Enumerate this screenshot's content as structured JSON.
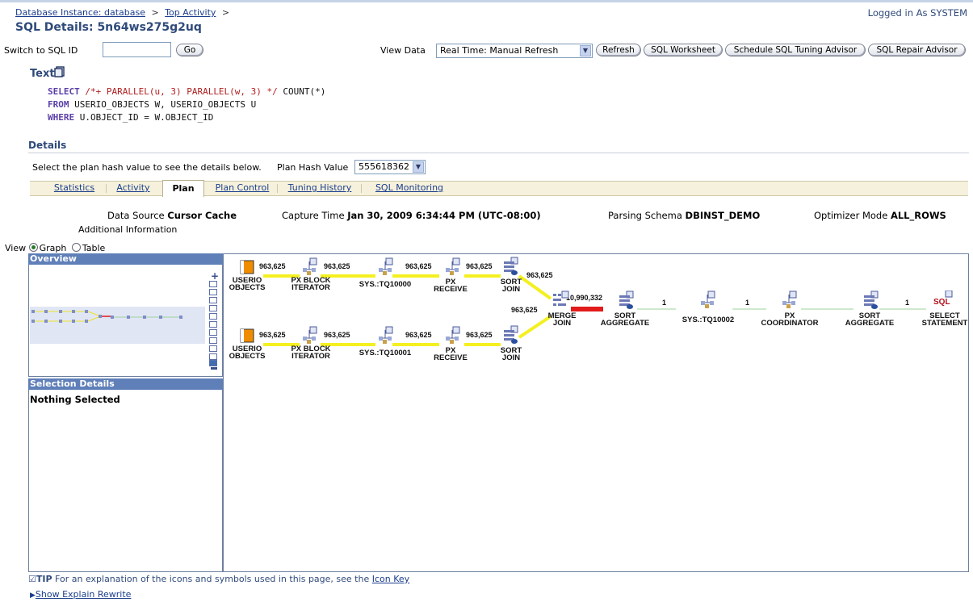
{
  "breadcrumb": {
    "instance": "Database Instance: database",
    "sep1": ">",
    "top_activity": "Top Activity",
    "sep2": ">"
  },
  "login": "Logged in As SYSTEM",
  "page_title": "SQL Details: 5n64ws275g2uq",
  "toolbar": {
    "switch_label": "Switch to SQL ID",
    "switch_value": "",
    "go": "Go",
    "view_data_label": "View Data",
    "view_data_value": "Real Time: Manual Refresh",
    "refresh": "Refresh",
    "sql_worksheet": "SQL Worksheet",
    "tuning_advisor": "Schedule SQL Tuning Advisor",
    "repair_advisor": "SQL Repair Advisor"
  },
  "text_section": {
    "title": "Text",
    "line1_kw": "SELECT",
    "line1_hint": " /*+ PARALLEL(u, 3) PARALLEL(w, 3) */",
    "line1_rest": " COUNT(*)",
    "line2_kw": "FROM",
    "line2_rest": " USERIO_OBJECTS W, USERIO_OBJECTS U",
    "line3_kw": "WHERE",
    "line3_rest": " U.OBJECT_ID = W.OBJECT_ID"
  },
  "details": {
    "title": "Details",
    "instruction": "Select the plan hash value to see the details below.",
    "hash_label": "Plan Hash Value",
    "hash_value": "555618362"
  },
  "tabs": [
    "Statistics",
    "Activity",
    "Plan",
    "Plan Control",
    "Tuning History",
    "SQL Monitoring"
  ],
  "info": {
    "data_source_label": "Data Source",
    "data_source": "Cursor Cache",
    "capture_label": "Capture Time",
    "capture": "Jan 30, 2009 6:34:44 PM (UTC-08:00)",
    "schema_label": "Parsing Schema",
    "schema": "DBINST_DEMO",
    "optimizer_label": "Optimizer Mode",
    "optimizer": "ALL_ROWS",
    "additional": "Additional Information"
  },
  "view": {
    "label": "View",
    "graph": "Graph",
    "table": "Table"
  },
  "overview_title": "Overview",
  "selection": {
    "title": "Selection Details",
    "text": "Nothing Selected"
  },
  "graph": {
    "top": {
      "n1a": "USERIO",
      "n1b": "OBJECTS",
      "e1": "963,625",
      "n2a": "PX BLOCK",
      "n2b": "ITERATOR",
      "e2": "963,625",
      "n3": "SYS.:TQ10000",
      "e3": "963,625",
      "n4a": "PX",
      "n4b": "RECEIVE",
      "e4": "963,625",
      "n5a": "SORT",
      "n5b": "JOIN",
      "e5": "963,625"
    },
    "bottom": {
      "n1a": "USERIO",
      "n1b": "OBJECTS",
      "e1": "963,625",
      "n2a": "PX BLOCK",
      "n2b": "ITERATOR",
      "e2": "963,625",
      "n3": "SYS.:TQ10001",
      "e3": "963,625",
      "n4a": "PX",
      "n4b": "RECEIVE",
      "e4": "963,625",
      "n5a": "SORT",
      "n5b": "JOIN",
      "e5": "963,625"
    },
    "merge": {
      "a": "MERGE",
      "b": "JOIN",
      "rows": "10,990,332"
    },
    "chain": {
      "s1a": "SORT",
      "s1b": "AGGREGATE",
      "e1": "1",
      "tq": "SYS.:TQ10002",
      "e2": "1",
      "pxa": "PX",
      "pxb": "COORDINATOR",
      "s2a": "SORT",
      "s2b": "AGGREGATE",
      "e3": "1",
      "sqlicon": "SQL",
      "sela": "SELECT",
      "selb": "STATEMENT"
    }
  },
  "tip": {
    "label": "TIP",
    "text": "For an explanation of the icons and symbols used in this page, see the",
    "link": "Icon Key"
  },
  "explain_link": "Show Explain Rewrite",
  "colors": {
    "heavy_edge": "#e21b1b",
    "edge": "#f4f020",
    "light_edge": "#9cd39c",
    "panel_header": "#5f7fb8"
  }
}
